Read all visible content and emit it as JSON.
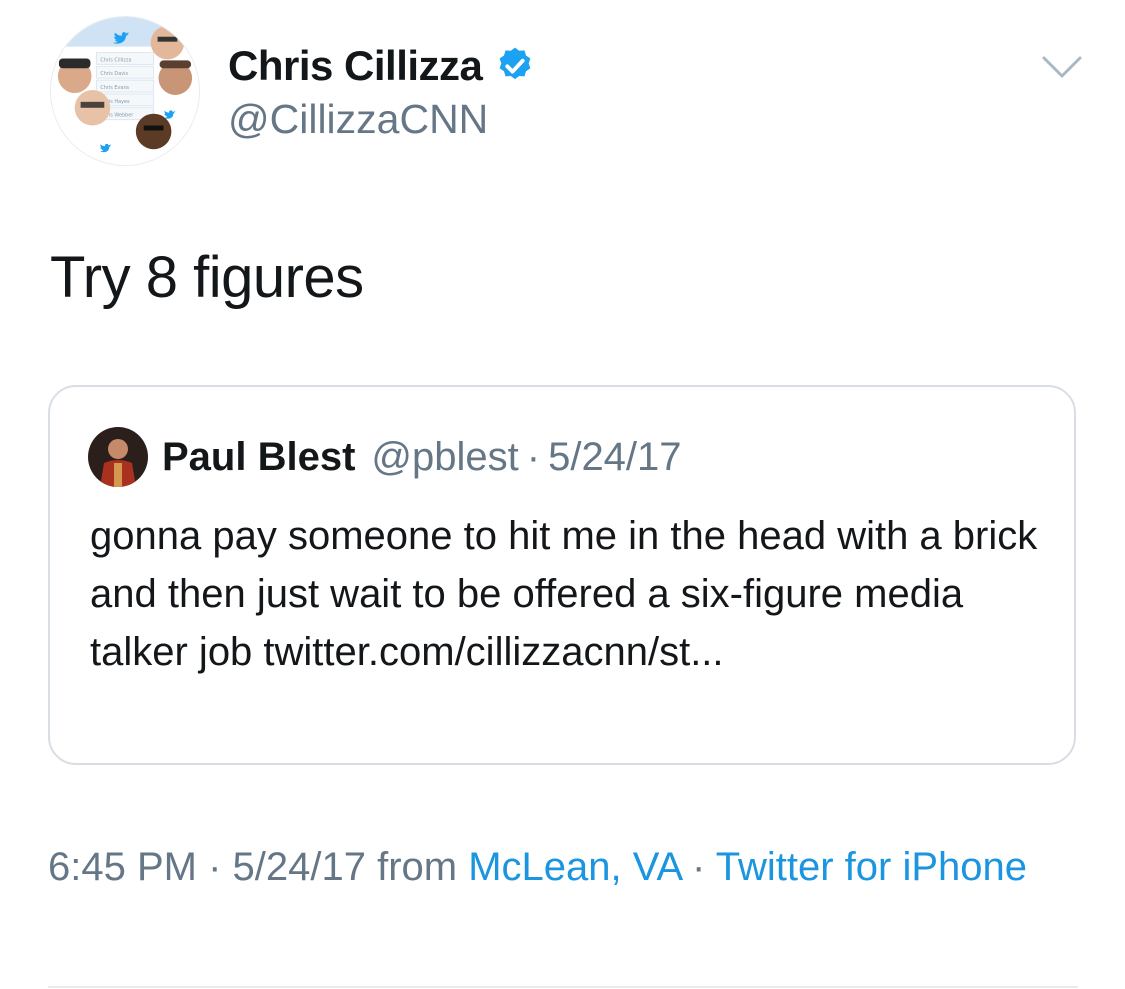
{
  "author": {
    "display_name": "Chris Cillizza",
    "handle": "@CillizzaCNN",
    "verified": true,
    "avatar_labels": [
      "Chris Cillizza",
      "Chris Davis",
      "Chris Evans",
      "Chris Hayes",
      "Chris Webber"
    ]
  },
  "tweet": {
    "text": "Try 8 figures"
  },
  "quoted_tweet": {
    "name": "Paul Blest",
    "handle": "@pblest",
    "separator": "·",
    "date": "5/24/17",
    "body": "gonna pay someone to hit me in the head with a brick and then just wait to be offered a six-figure media talker job twitter.com/cillizzacnn/st..."
  },
  "meta": {
    "time": "6:45 PM",
    "sep1": " · ",
    "date": "5/24/17",
    "from": " from ",
    "location": "McLean, VA",
    "sep2": " · ",
    "source": "Twitter for iPhone"
  },
  "colors": {
    "link": "#1b95e0",
    "secondary_text": "#657786",
    "verified_badge": "#1da1f2"
  },
  "icons": [
    "verified-badge-icon",
    "chevron-down-icon",
    "twitter-bird-icon"
  ]
}
